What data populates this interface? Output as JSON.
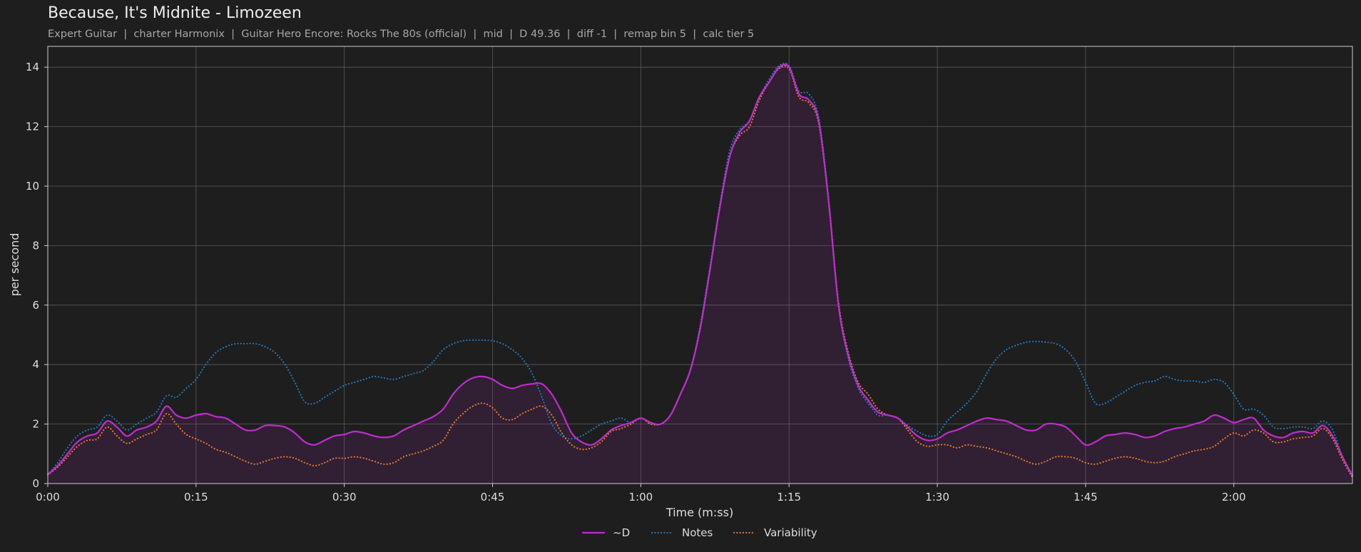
{
  "chart_data": {
    "type": "line",
    "title": "Because, It's Midnite - Limozeen",
    "subtitle": "Expert Guitar  |  charter Harmonix  |  Guitar Hero Encore: Rocks The 80s (official)  |  mid  |  D 49.36  |  diff -1  |  remap bin 5  |  calc tier 5",
    "xlabel": "Time (m:ss)",
    "ylabel": "per second",
    "xlim": [
      0,
      132
    ],
    "ylim": [
      0,
      14.7
    ],
    "xticks": [
      {
        "value": 0,
        "label": "0:00"
      },
      {
        "value": 15,
        "label": "0:15"
      },
      {
        "value": 30,
        "label": "0:30"
      },
      {
        "value": 45,
        "label": "0:45"
      },
      {
        "value": 60,
        "label": "1:00"
      },
      {
        "value": 75,
        "label": "1:15"
      },
      {
        "value": 90,
        "label": "1:30"
      },
      {
        "value": 105,
        "label": "1:45"
      },
      {
        "value": 120,
        "label": "2:00"
      }
    ],
    "yticks": [
      0,
      2,
      4,
      6,
      8,
      10,
      12,
      14
    ],
    "grid": true,
    "legend_position": "bottom-center",
    "series": [
      {
        "name": "~D",
        "color": "#c02ccf",
        "style": "solid",
        "fill": true,
        "x": [
          0,
          1,
          2,
          3,
          4,
          5,
          6,
          7,
          8,
          9,
          10,
          11,
          12,
          13,
          14,
          15,
          16,
          17,
          18,
          19,
          20,
          21,
          22,
          23,
          24,
          25,
          26,
          27,
          28,
          29,
          30,
          31,
          32,
          33,
          34,
          35,
          36,
          37,
          38,
          39,
          40,
          41,
          42,
          43,
          44,
          45,
          46,
          47,
          48,
          49,
          50,
          51,
          52,
          53,
          54,
          55,
          56,
          57,
          58,
          59,
          60,
          61,
          62,
          63,
          64,
          65,
          66,
          67,
          68,
          69,
          70,
          71,
          72,
          73,
          74,
          75,
          76,
          77,
          78,
          79,
          80,
          81,
          82,
          83,
          84,
          85,
          86,
          87,
          88,
          89,
          90,
          91,
          92,
          93,
          94,
          95,
          96,
          97,
          98,
          99,
          100,
          101,
          102,
          103,
          104,
          105,
          106,
          107,
          108,
          109,
          110,
          111,
          112,
          113,
          114,
          115,
          116,
          117,
          118,
          119,
          120,
          121,
          122,
          123,
          124,
          125,
          126,
          127,
          128,
          129,
          130,
          131,
          132
        ],
        "values": [
          0.3,
          0.6,
          1.0,
          1.4,
          1.6,
          1.7,
          2.1,
          1.9,
          1.6,
          1.8,
          1.9,
          2.1,
          2.6,
          2.3,
          2.2,
          2.3,
          2.35,
          2.25,
          2.2,
          2.0,
          1.8,
          1.8,
          1.95,
          1.95,
          1.9,
          1.7,
          1.4,
          1.3,
          1.45,
          1.6,
          1.65,
          1.75,
          1.7,
          1.6,
          1.55,
          1.6,
          1.8,
          1.95,
          2.1,
          2.25,
          2.5,
          3.0,
          3.35,
          3.55,
          3.6,
          3.5,
          3.3,
          3.2,
          3.3,
          3.35,
          3.35,
          3.0,
          2.4,
          1.7,
          1.4,
          1.3,
          1.5,
          1.8,
          1.95,
          2.05,
          2.2,
          2.05,
          2.0,
          2.3,
          3.0,
          3.8,
          5.2,
          7.2,
          9.3,
          11.0,
          11.8,
          12.2,
          13.0,
          13.5,
          14.0,
          14.0,
          13.1,
          12.9,
          12.2,
          9.5,
          6.0,
          4.3,
          3.3,
          2.8,
          2.4,
          2.3,
          2.2,
          1.9,
          1.6,
          1.45,
          1.5,
          1.7,
          1.8,
          1.95,
          2.1,
          2.2,
          2.15,
          2.1,
          1.95,
          1.8,
          1.8,
          2.0,
          2.0,
          1.9,
          1.6,
          1.3,
          1.4,
          1.6,
          1.65,
          1.7,
          1.65,
          1.55,
          1.6,
          1.75,
          1.85,
          1.9,
          2.0,
          2.1,
          2.3,
          2.2,
          2.05,
          2.15,
          2.2,
          1.8,
          1.6,
          1.55,
          1.7,
          1.75,
          1.7,
          1.95,
          1.6,
          0.9,
          0.25
        ]
      },
      {
        "name": "Notes",
        "color": "#1f77b4",
        "style": "dotted",
        "fill": false,
        "x": [
          0,
          1,
          2,
          3,
          4,
          5,
          6,
          7,
          8,
          9,
          10,
          11,
          12,
          13,
          14,
          15,
          16,
          17,
          18,
          19,
          20,
          21,
          22,
          23,
          24,
          25,
          26,
          27,
          28,
          29,
          30,
          31,
          32,
          33,
          34,
          35,
          36,
          37,
          38,
          39,
          40,
          41,
          42,
          43,
          44,
          45,
          46,
          47,
          48,
          49,
          50,
          51,
          52,
          53,
          54,
          55,
          56,
          57,
          58,
          59,
          60,
          61,
          62,
          63,
          64,
          65,
          66,
          67,
          68,
          69,
          70,
          71,
          72,
          73,
          74,
          75,
          76,
          77,
          78,
          79,
          80,
          81,
          82,
          83,
          84,
          85,
          86,
          87,
          88,
          89,
          90,
          91,
          92,
          93,
          94,
          95,
          96,
          97,
          98,
          99,
          100,
          101,
          102,
          103,
          104,
          105,
          106,
          107,
          108,
          109,
          110,
          111,
          112,
          113,
          114,
          115,
          116,
          117,
          118,
          119,
          120,
          121,
          122,
          123,
          124,
          125,
          126,
          127,
          128,
          129,
          130,
          131,
          132
        ],
        "values": [
          0.3,
          0.7,
          1.2,
          1.6,
          1.8,
          1.9,
          2.3,
          2.1,
          1.8,
          2.0,
          2.2,
          2.4,
          2.95,
          2.9,
          3.2,
          3.5,
          4.0,
          4.4,
          4.6,
          4.7,
          4.7,
          4.7,
          4.6,
          4.4,
          4.0,
          3.4,
          2.75,
          2.7,
          2.9,
          3.1,
          3.3,
          3.4,
          3.5,
          3.6,
          3.55,
          3.5,
          3.6,
          3.7,
          3.8,
          4.1,
          4.5,
          4.7,
          4.8,
          4.82,
          4.82,
          4.8,
          4.7,
          4.5,
          4.2,
          3.7,
          2.9,
          2.0,
          1.6,
          1.5,
          1.6,
          1.8,
          2.0,
          2.1,
          2.2,
          2.05,
          2.2,
          2.05,
          2.0,
          2.3,
          3.0,
          3.8,
          5.3,
          7.3,
          9.4,
          11.2,
          11.9,
          12.2,
          13.0,
          13.6,
          14.05,
          14.05,
          13.2,
          13.1,
          12.3,
          9.6,
          6.0,
          4.2,
          3.2,
          2.7,
          2.3,
          2.3,
          2.2,
          1.95,
          1.75,
          1.6,
          1.65,
          2.1,
          2.4,
          2.7,
          3.1,
          3.7,
          4.2,
          4.5,
          4.65,
          4.75,
          4.78,
          4.75,
          4.7,
          4.5,
          4.1,
          3.4,
          2.7,
          2.7,
          2.9,
          3.1,
          3.3,
          3.4,
          3.45,
          3.6,
          3.5,
          3.45,
          3.45,
          3.4,
          3.5,
          3.4,
          3.0,
          2.5,
          2.5,
          2.3,
          1.9,
          1.85,
          1.9,
          1.9,
          1.85,
          2.1,
          1.8,
          0.9,
          0.3
        ]
      },
      {
        "name": "Variability",
        "color": "#e07a2a",
        "style": "dotted",
        "fill": false,
        "x": [
          0,
          1,
          2,
          3,
          4,
          5,
          6,
          7,
          8,
          9,
          10,
          11,
          12,
          13,
          14,
          15,
          16,
          17,
          18,
          19,
          20,
          21,
          22,
          23,
          24,
          25,
          26,
          27,
          28,
          29,
          30,
          31,
          32,
          33,
          34,
          35,
          36,
          37,
          38,
          39,
          40,
          41,
          42,
          43,
          44,
          45,
          46,
          47,
          48,
          49,
          50,
          51,
          52,
          53,
          54,
          55,
          56,
          57,
          58,
          59,
          60,
          61,
          62,
          63,
          64,
          65,
          66,
          67,
          68,
          69,
          70,
          71,
          72,
          73,
          74,
          75,
          76,
          77,
          78,
          79,
          80,
          81,
          82,
          83,
          84,
          85,
          86,
          87,
          88,
          89,
          90,
          91,
          92,
          93,
          94,
          95,
          96,
          97,
          98,
          99,
          100,
          101,
          102,
          103,
          104,
          105,
          106,
          107,
          108,
          109,
          110,
          111,
          112,
          113,
          114,
          115,
          116,
          117,
          118,
          119,
          120,
          121,
          122,
          123,
          124,
          125,
          126,
          127,
          128,
          129,
          130,
          131,
          132
        ],
        "values": [
          0.3,
          0.55,
          0.9,
          1.25,
          1.45,
          1.5,
          1.9,
          1.6,
          1.35,
          1.5,
          1.65,
          1.8,
          2.35,
          2.0,
          1.65,
          1.5,
          1.35,
          1.15,
          1.05,
          0.9,
          0.75,
          0.65,
          0.75,
          0.85,
          0.9,
          0.85,
          0.7,
          0.6,
          0.7,
          0.85,
          0.85,
          0.9,
          0.85,
          0.75,
          0.65,
          0.7,
          0.9,
          1.0,
          1.1,
          1.25,
          1.45,
          2.0,
          2.35,
          2.6,
          2.7,
          2.55,
          2.2,
          2.15,
          2.35,
          2.5,
          2.6,
          2.3,
          1.7,
          1.3,
          1.15,
          1.2,
          1.4,
          1.75,
          1.85,
          2.0,
          2.2,
          2.0,
          2.0,
          2.3,
          3.0,
          3.8,
          5.2,
          7.2,
          9.3,
          11.0,
          11.7,
          12.0,
          12.9,
          13.5,
          13.95,
          13.95,
          13.0,
          12.8,
          12.1,
          9.5,
          6.1,
          4.4,
          3.4,
          3.0,
          2.5,
          2.3,
          2.2,
          1.8,
          1.4,
          1.25,
          1.3,
          1.3,
          1.2,
          1.3,
          1.25,
          1.2,
          1.1,
          1.0,
          0.9,
          0.75,
          0.65,
          0.75,
          0.9,
          0.9,
          0.85,
          0.7,
          0.65,
          0.75,
          0.85,
          0.9,
          0.85,
          0.75,
          0.7,
          0.75,
          0.9,
          1.0,
          1.1,
          1.15,
          1.25,
          1.5,
          1.7,
          1.6,
          1.8,
          1.7,
          1.4,
          1.4,
          1.5,
          1.55,
          1.6,
          1.85,
          1.5,
          0.8,
          0.2
        ]
      }
    ]
  }
}
